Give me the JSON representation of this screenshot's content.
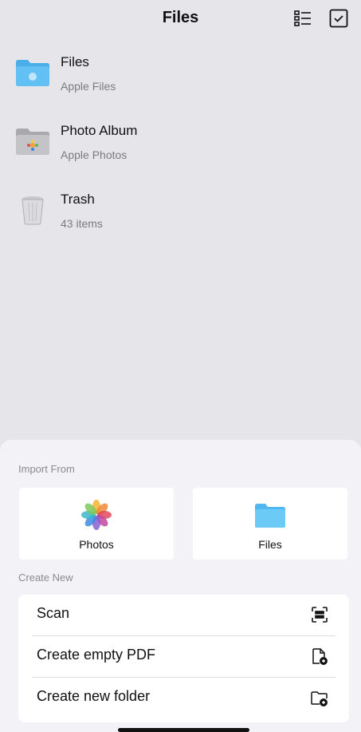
{
  "header": {
    "title": "Files"
  },
  "locations": [
    {
      "title": "Files",
      "subtitle": "Apple Files",
      "icon": "blue-folder-icon"
    },
    {
      "title": "Photo Album",
      "subtitle": "Apple Photos",
      "icon": "photo-album-folder-icon"
    },
    {
      "title": "Trash",
      "subtitle": "43 items",
      "icon": "trash-bin-icon"
    }
  ],
  "sheet": {
    "import_label": "Import From",
    "import_options": [
      {
        "label": "Photos",
        "icon": "photos-flower-icon"
      },
      {
        "label": "Files",
        "icon": "folder-icon"
      }
    ],
    "create_label": "Create New",
    "create_options": [
      {
        "label": "Scan",
        "icon": "scan-icon"
      },
      {
        "label": "Create empty PDF",
        "icon": "new-document-icon"
      },
      {
        "label": "Create new folder",
        "icon": "new-folder-icon"
      }
    ]
  },
  "colors": {
    "background": "#e5e5ea",
    "sheet": "#f2f2f7",
    "folder_blue": "#5ac8fa"
  }
}
